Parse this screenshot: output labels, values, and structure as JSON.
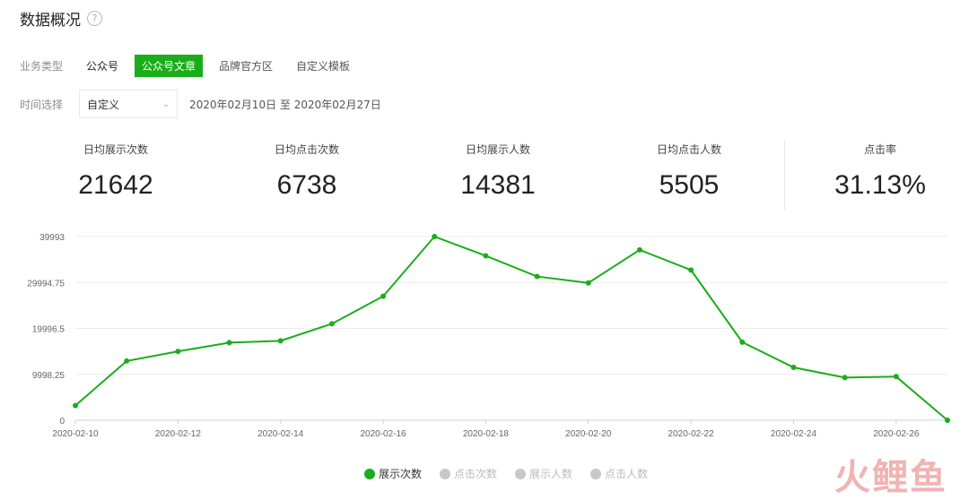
{
  "header": {
    "title": "数据概况",
    "help_icon": "?"
  },
  "business": {
    "label": "业务类型",
    "options": [
      "公众号",
      "公众号文章",
      "品牌官方区",
      "自定义模板"
    ],
    "active_index": 1
  },
  "time": {
    "label": "时间选择",
    "select_value": "自定义",
    "range": "2020年02月10日 至 2020年02月27日"
  },
  "stats": [
    {
      "label": "日均展示次数",
      "value": "21642"
    },
    {
      "label": "日均点击次数",
      "value": "6738"
    },
    {
      "label": "日均展示人数",
      "value": "14381"
    },
    {
      "label": "日均点击人数",
      "value": "5505"
    },
    {
      "label": "点击率",
      "value": "31.13%"
    }
  ],
  "chart_data": {
    "type": "line",
    "x": [
      "2020-02-10",
      "2020-02-11",
      "2020-02-12",
      "2020-02-13",
      "2020-02-14",
      "2020-02-15",
      "2020-02-16",
      "2020-02-17",
      "2020-02-18",
      "2020-02-19",
      "2020-02-20",
      "2020-02-21",
      "2020-02-22",
      "2020-02-23",
      "2020-02-24",
      "2020-02-25",
      "2020-02-26",
      "2020-02-27"
    ],
    "x_tick_labels": [
      "2020-02-10",
      "2020-02-12",
      "2020-02-14",
      "2020-02-16",
      "2020-02-18",
      "2020-02-20",
      "2020-02-22",
      "2020-02-24",
      "2020-02-26"
    ],
    "y_ticks": [
      "0",
      "9998.25",
      "19996.5",
      "29994.75",
      "39993"
    ],
    "ylim": [
      0,
      39993
    ],
    "series": [
      {
        "name": "展示次数",
        "color": "#1aad19",
        "values": [
          3200,
          12900,
          15000,
          16900,
          17300,
          21000,
          27000,
          39993,
          35800,
          31300,
          29900,
          37100,
          32700,
          17000,
          11500,
          9300,
          9500,
          0
        ]
      }
    ],
    "grid": true,
    "legend": [
      "展示次数",
      "点击次数",
      "展示人数",
      "点击人数"
    ],
    "legend_placement": "bottom-center"
  },
  "watermark": "火鲤鱼"
}
